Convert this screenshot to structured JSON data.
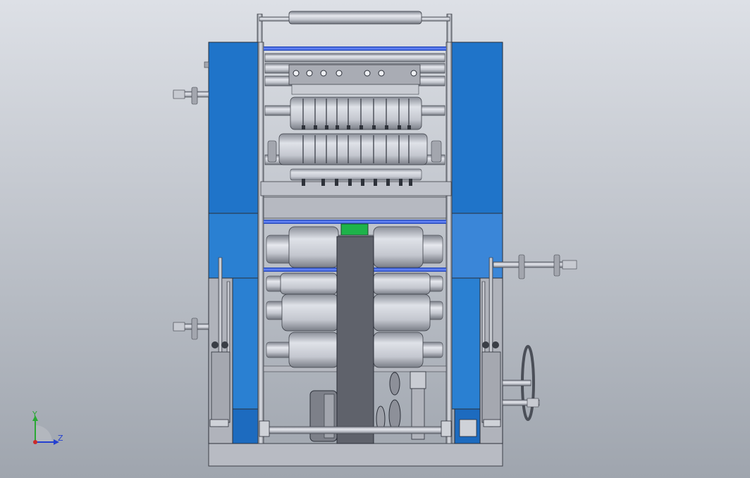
{
  "viewport": {
    "background_top": "#dde0e6",
    "background_bottom": "#9fa5ae"
  },
  "colors": {
    "guard_blue": "#1f74c9",
    "guard_blue_light": "#3a8ad8",
    "steel": "#b9bcc4",
    "steel_dark": "#6d7079",
    "roller_blue": "#2f5fe0",
    "accent_green": "#1eb34a"
  },
  "triad": {
    "y_label": "Y",
    "z_label": "Z",
    "y_color": "#2aa834",
    "z_color": "#2440d0",
    "x_color": "#cc2a2a"
  }
}
